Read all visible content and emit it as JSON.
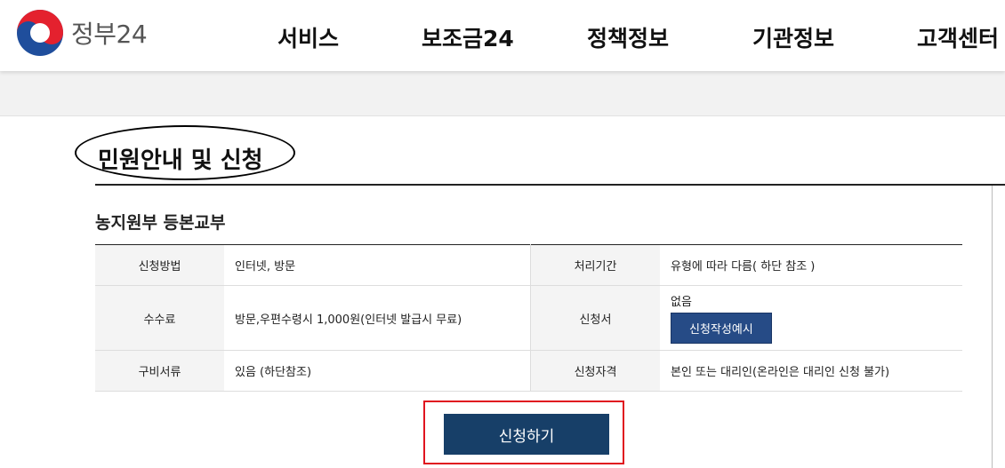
{
  "header": {
    "logo_text": "정부24",
    "nav": [
      "서비스",
      "보조금24",
      "정책정보",
      "기관정보",
      "고객센터"
    ]
  },
  "page_title": "민원안내 및 신청",
  "section_title": "농지원부 등본교부",
  "info": {
    "rows": [
      {
        "label1": "신청방법",
        "value1": "인터넷, 방문",
        "label2": "처리기간",
        "value2": "유형에 따라 다름( 하단 참조 )"
      },
      {
        "label1": "수수료",
        "value1": "방문,우편수령시 1,000원(인터넷 발급시 무료)",
        "label2": "신청서",
        "value2": "없음",
        "button": "신청작성예시"
      },
      {
        "label1": "구비서류",
        "value1": "있음 (하단참조)",
        "label2": "신청자격",
        "value2": "본인 또는 대리인(온라인은 대리인 신청 불가)"
      }
    ]
  },
  "apply_button": "신청하기"
}
